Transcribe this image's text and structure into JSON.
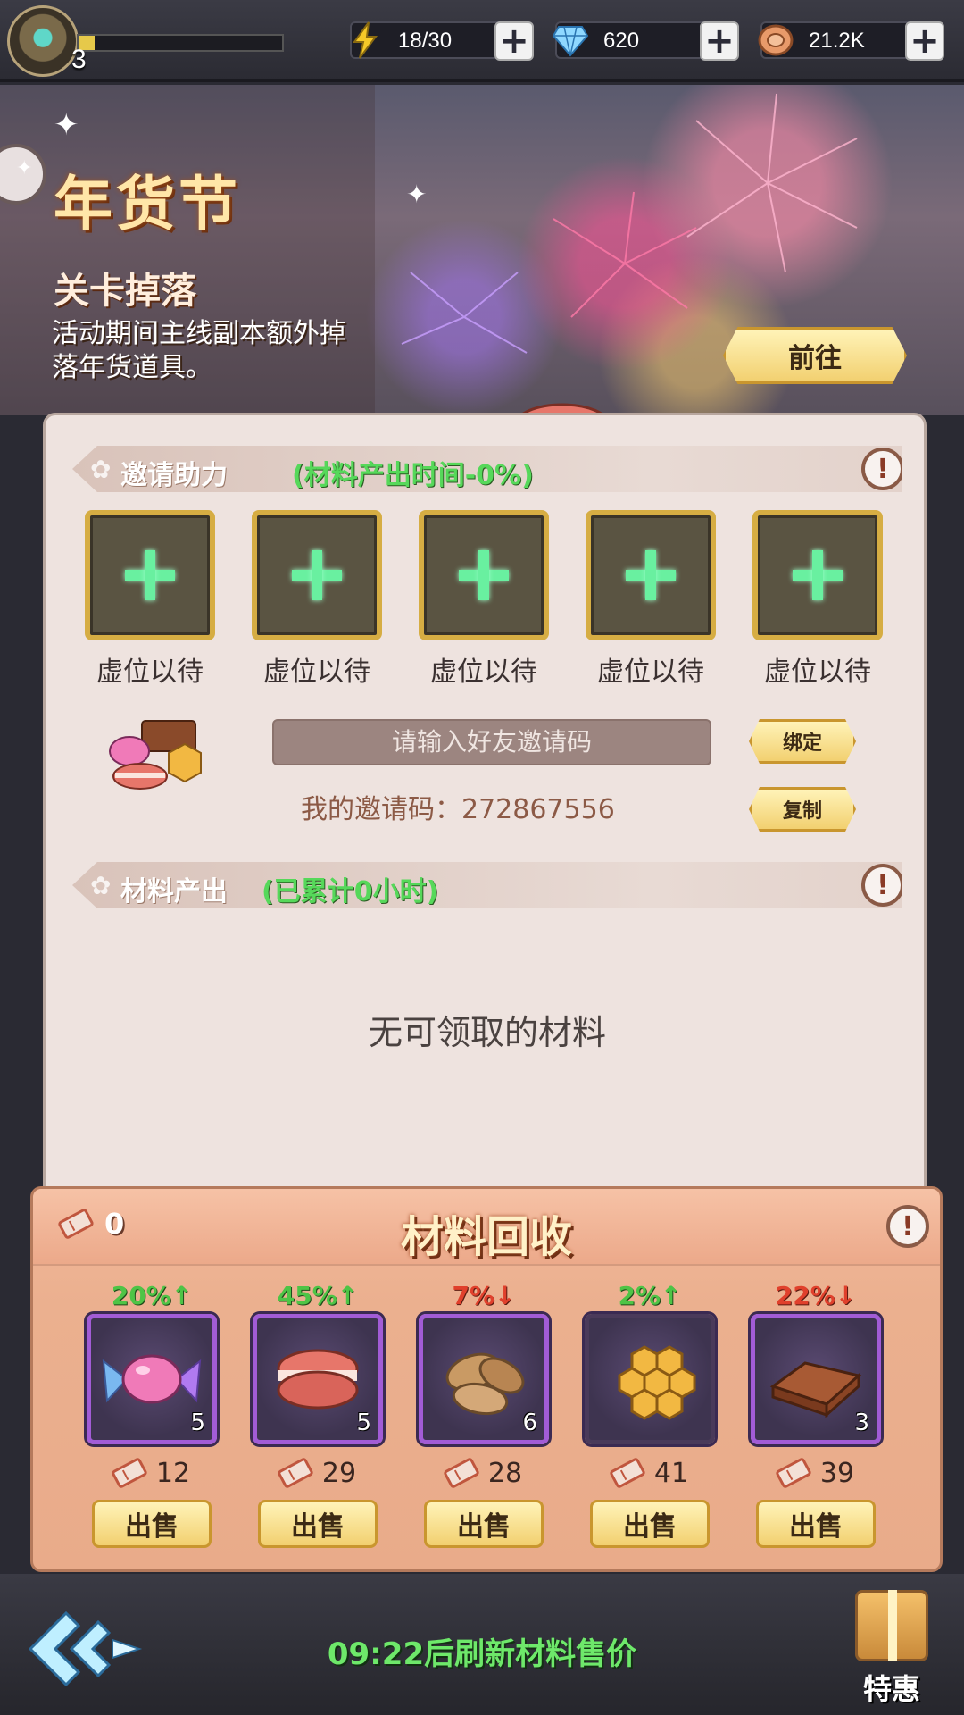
{
  "topbar": {
    "level": "3",
    "xp_progress": 0.08,
    "energy": {
      "icon": "lightning-icon",
      "value": "18/30"
    },
    "gems": {
      "icon": "diamond-icon",
      "value": "620"
    },
    "coins": {
      "icon": "coin-icon",
      "value": "21.2K"
    }
  },
  "banner": {
    "title": "年货节",
    "subtitle": "关卡掉落",
    "description": "活动期间主线副本额外掉落年货道具。",
    "goto_label": "前往"
  },
  "invite": {
    "title": "邀请助力",
    "bonus": "(材料产出时间-0%)",
    "slots": [
      {
        "label": "虚位以待"
      },
      {
        "label": "虚位以待"
      },
      {
        "label": "虚位以待"
      },
      {
        "label": "虚位以待"
      },
      {
        "label": "虚位以待"
      }
    ],
    "input_placeholder": "请输入好友邀请码",
    "my_code_label": "我的邀请码：272867556",
    "bind_label": "绑定",
    "copy_label": "复制"
  },
  "production": {
    "title": "材料产出",
    "accumulated": "(已累计0小时)",
    "empty_message": "无可领取的材料"
  },
  "recycle": {
    "ticket_count": "0",
    "title": "材料回收",
    "sell_label": "出售",
    "items": [
      {
        "name": "candy",
        "icon": "candy-icon",
        "trend": "20%↑",
        "direction": "up",
        "quantity": "5",
        "price": "12"
      },
      {
        "name": "macaron",
        "icon": "macaron-icon",
        "trend": "45%↑",
        "direction": "up",
        "quantity": "5",
        "price": "29"
      },
      {
        "name": "almond",
        "icon": "almond-icon",
        "trend": "7%↓",
        "direction": "down",
        "quantity": "6",
        "price": "28"
      },
      {
        "name": "honeycomb",
        "icon": "honeycomb-icon",
        "trend": "2%↑",
        "direction": "up",
        "quantity": "",
        "price": "41"
      },
      {
        "name": "chocolate",
        "icon": "chocolate-icon",
        "trend": "22%↓",
        "direction": "down",
        "quantity": "3",
        "price": "39"
      }
    ]
  },
  "footer": {
    "refresh_text": "09:22后刷新材料售价",
    "special_label": "特惠"
  },
  "colors": {
    "accent_gold": "#f2d070",
    "trend_up": "#4ec446",
    "trend_down": "#e0402c",
    "slot_plus": "#69f0a0"
  }
}
